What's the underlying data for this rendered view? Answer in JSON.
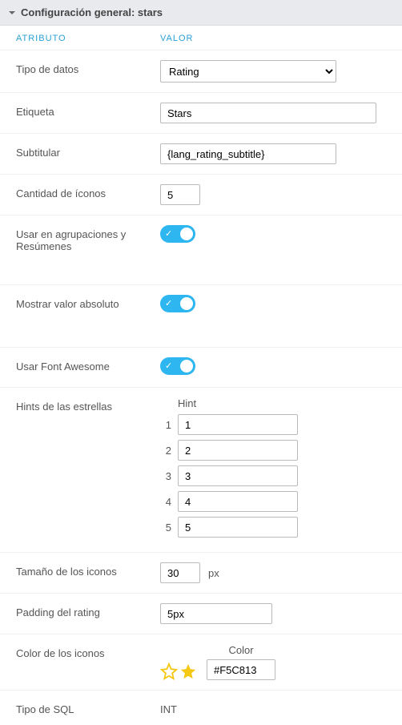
{
  "panel": {
    "title": "Configuración general: stars"
  },
  "columns": {
    "attribute": "ATRIBUTO",
    "value": "VALOR"
  },
  "rows": {
    "data_type": {
      "label": "Tipo de datos",
      "value": "Rating"
    },
    "etiqueta": {
      "label": "Etiqueta",
      "value": "Stars"
    },
    "subtitle": {
      "label": "Subtitular",
      "value": "{lang_rating_subtitle}"
    },
    "icon_count": {
      "label": "Cantidad de íconos",
      "value": "5"
    },
    "use_group": {
      "label": "Usar en agrupaciones y Resúmenes",
      "value": true
    },
    "show_abs": {
      "label": "Mostrar valor absoluto",
      "value": true
    },
    "font_awesome": {
      "label": "Usar Font Awesome",
      "value": true
    },
    "hints": {
      "label": "Hints de las estrellas",
      "col_header": "Hint",
      "items": [
        {
          "idx": "1",
          "value": "1"
        },
        {
          "idx": "2",
          "value": "2"
        },
        {
          "idx": "3",
          "value": "3"
        },
        {
          "idx": "4",
          "value": "4"
        },
        {
          "idx": "5",
          "value": "5"
        }
      ]
    },
    "icon_size": {
      "label": "Tamaño de los iconos",
      "value": "30",
      "unit": "px"
    },
    "padding": {
      "label": "Padding del rating",
      "value": "5px"
    },
    "color": {
      "label": "Color de los iconos",
      "col_label": "Color",
      "value": "#F5C813"
    },
    "sql_type": {
      "label": "Tipo de SQL",
      "value": "INT"
    }
  }
}
